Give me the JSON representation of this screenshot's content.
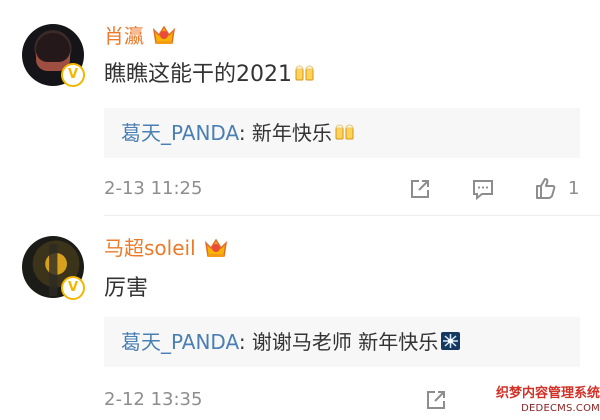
{
  "comments": [
    {
      "author": "肖瀛",
      "text": "瞧瞧这能干的2021",
      "emoji": "beer-toast-icon",
      "reply": {
        "user": "葛天_PANDA",
        "separator": ": ",
        "text": "新年快乐",
        "emoji": "beer-toast-icon"
      },
      "date": "2-13 11:25",
      "likes": "1"
    },
    {
      "author": "马超soleil",
      "text": "厉害",
      "reply": {
        "user": "葛天_PANDA",
        "separator": ": ",
        "text": "谢谢马老师 新年快乐",
        "emoji": "fireworks-icon"
      },
      "date": "2-12 13:35"
    }
  ],
  "watermark": {
    "line1": "织梦内容管理系统",
    "line2": "DEDECMS.COM"
  },
  "colors": {
    "author": "#ec7a2b",
    "reply_user": "#4a7fb3",
    "text": "#333333",
    "meta": "#8d8d8d",
    "reply_bg": "#f7f7f7",
    "verified": "#f4b600"
  }
}
